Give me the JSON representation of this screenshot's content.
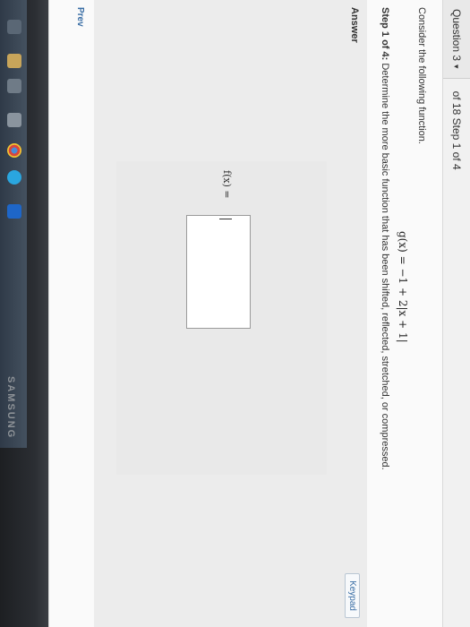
{
  "header": {
    "question_label": "Question 3",
    "question_chevron": "▾",
    "step_counter": "of 18 Step 1 of 4"
  },
  "problem": {
    "intro": "Consider the following function.",
    "formula": "g(x) = −1 + 2|x + 1|",
    "step_prefix": "Step 1 of 4:",
    "step_text": " Determine the more basic function that has been shifted, reflected, stretched, or compressed."
  },
  "answer": {
    "label": "Answer",
    "keypad_label": "Keypad",
    "fx_label": "f(x) ="
  },
  "nav": {
    "prev_label": "Prev"
  },
  "monitor": {
    "brand": "SAMSUNG"
  },
  "taskbar": {
    "icons": [
      "start-icon",
      "file-explorer-icon",
      "app-icon",
      "store-icon",
      "chrome-icon",
      "skype-icon",
      "outlook-icon"
    ]
  }
}
